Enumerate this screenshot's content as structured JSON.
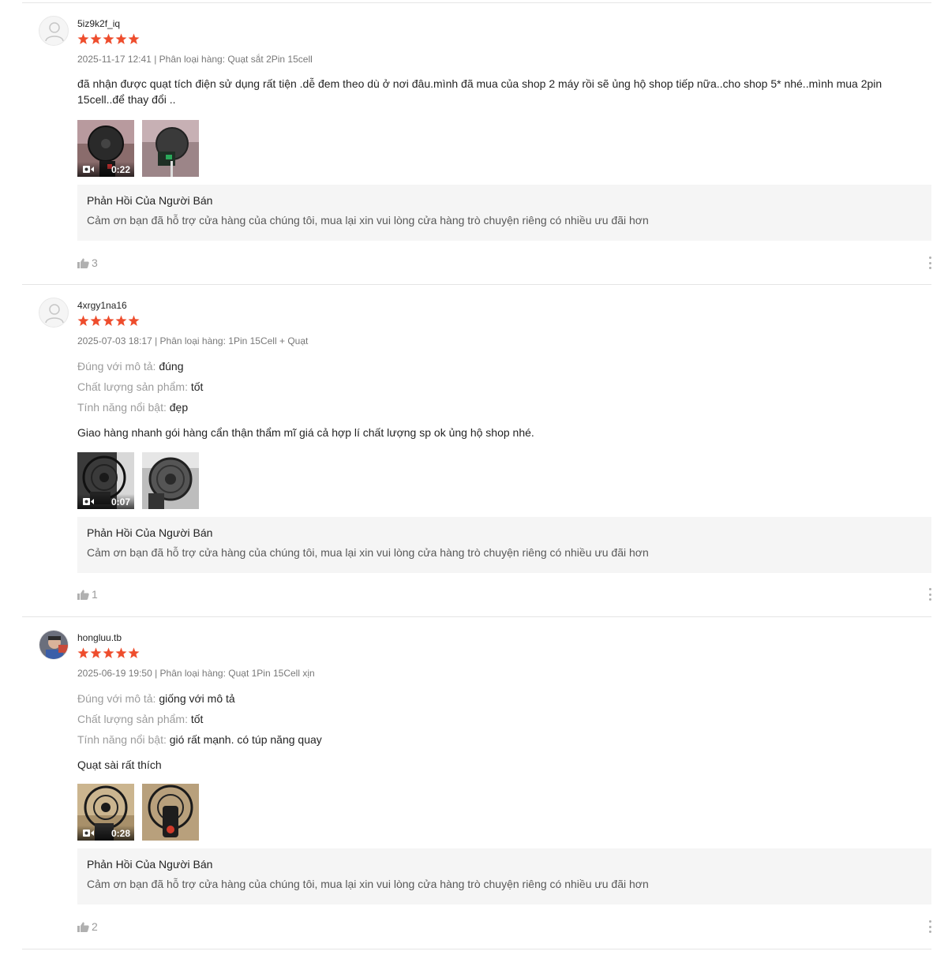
{
  "colors": {
    "star": "#ee4d2d",
    "reply_bg": "#f5f5f5",
    "divider": "#e5e5e5"
  },
  "reviews": [
    {
      "username": "5iz9k2f_iq",
      "rating": 5,
      "meta": "2025-11-17 12:41 | Phân loại hàng: Quạt sắt 2Pin 15cell",
      "attributes": [],
      "comment": "đã nhận được quạt tích điện sử dụng rất tiện .dễ đem theo dù ở nơi đâu.mình đã mua của shop 2 máy rồi sẽ ủng hộ shop tiếp nữa..cho shop 5* nhé..mình mua 2pin 15cell..để thay đổi ..",
      "media": [
        {
          "type": "video",
          "duration": "0:22"
        },
        {
          "type": "image"
        }
      ],
      "seller_reply": {
        "title": "Phản Hồi Của Người Bán",
        "text": "Cảm ơn bạn đã hỗ trợ cửa hàng của chúng tôi, mua lại xin vui lòng cửa hàng trò chuyện riêng có nhiều ưu đãi hơn"
      },
      "likes": "3",
      "avatar": "default-avatar-icon"
    },
    {
      "username": "4xrgy1na16",
      "rating": 5,
      "meta": "2025-07-03 18:17 | Phân loại hàng: 1Pin 15Cell + Quạt",
      "attributes": [
        {
          "label": "Đúng với mô tả:",
          "value": "đúng"
        },
        {
          "label": "Chất lượng sản phẩm:",
          "value": "tốt"
        },
        {
          "label": "Tính năng nổi bật:",
          "value": "đẹp"
        }
      ],
      "comment": "Giao hàng nhanh gói hàng cẩn thận thẩm mĩ giá cả hợp lí chất lượng sp ok ủng hộ shop nhé.",
      "media": [
        {
          "type": "video",
          "duration": "0:07"
        },
        {
          "type": "image"
        }
      ],
      "seller_reply": {
        "title": "Phản Hồi Của Người Bán",
        "text": "Cảm ơn bạn đã hỗ trợ cửa hàng của chúng tôi, mua lại xin vui lòng cửa hàng trò chuyện riêng có nhiều ưu đãi hơn"
      },
      "likes": "1",
      "avatar": "default-avatar-icon"
    },
    {
      "username": "hongluu.tb",
      "rating": 5,
      "meta": "2025-06-19 19:50 | Phân loại hàng: Quạt 1Pin 15Cell xịn",
      "attributes": [
        {
          "label": "Đúng với mô tả:",
          "value": "giống với mô tả"
        },
        {
          "label": "Chất lượng sản phẩm:",
          "value": "tốt"
        },
        {
          "label": "Tính năng nổi bật:",
          "value": "gió rất mạnh. có túp năng quay"
        }
      ],
      "comment": "Quạt sài rất thích",
      "media": [
        {
          "type": "video",
          "duration": "0:28"
        },
        {
          "type": "image"
        }
      ],
      "seller_reply": {
        "title": "Phản Hồi Của Người Bán",
        "text": "Cảm ơn bạn đã hỗ trợ cửa hàng của chúng tôi, mua lại xin vui lòng cửa hàng trò chuyện riêng có nhiều ưu đãi hơn"
      },
      "likes": "2",
      "avatar": "user-photo-avatar"
    }
  ]
}
